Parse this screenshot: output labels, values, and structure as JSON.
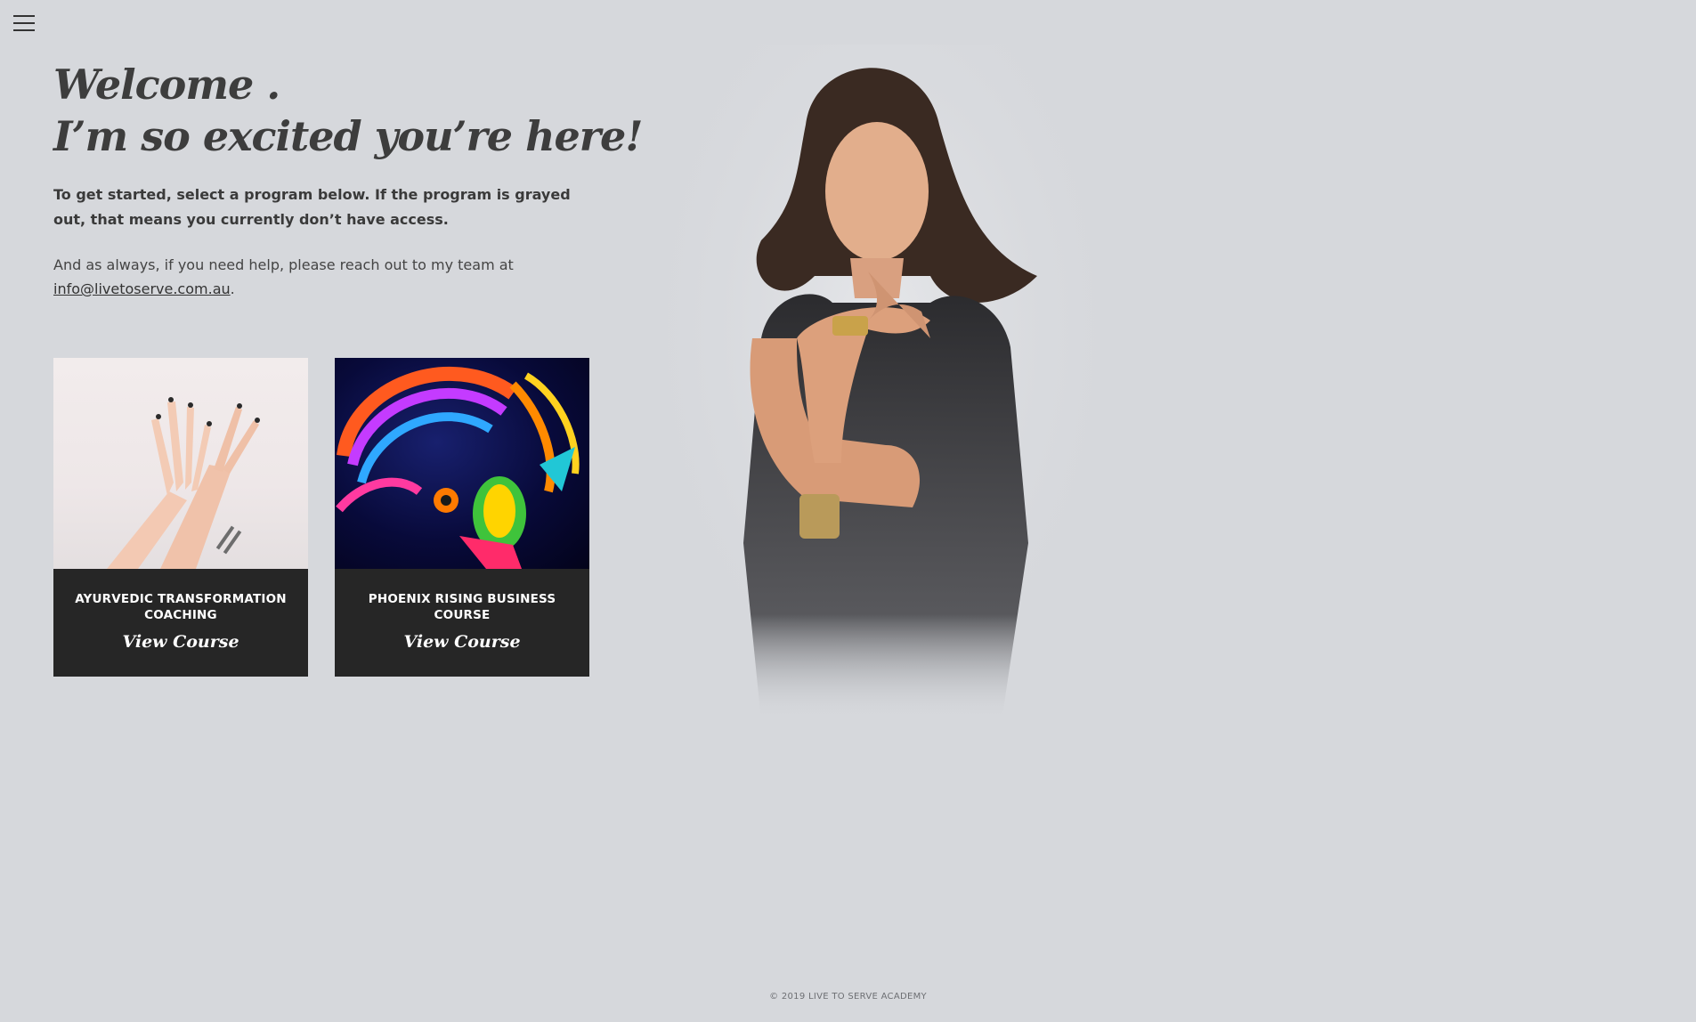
{
  "menu": {
    "icon": "hamburger-menu-icon"
  },
  "heading": {
    "line1": "Welcome .",
    "line2": "I’m so excited you’re here!"
  },
  "intro": {
    "bold_text": "To get started, select a program below. If the program is grayed out, that means you currently don’t have access.",
    "help_text": "And as always, if you need help, please reach out to my team at",
    "email": "info@livetoserve.com.au",
    "trailing": "."
  },
  "courses": [
    {
      "title": "AYURVEDIC TRANSFORMATION COACHING",
      "cta": "View Course"
    },
    {
      "title": "PHOENIX RISING BUSINESS COURSE",
      "cta": "View Course"
    }
  ],
  "footer": {
    "copyright": "© 2019 LIVE TO SERVE ACADEMY"
  },
  "colors": {
    "background": "#d6d8dc",
    "card": "#262626",
    "heading": "#3d3d3d"
  }
}
